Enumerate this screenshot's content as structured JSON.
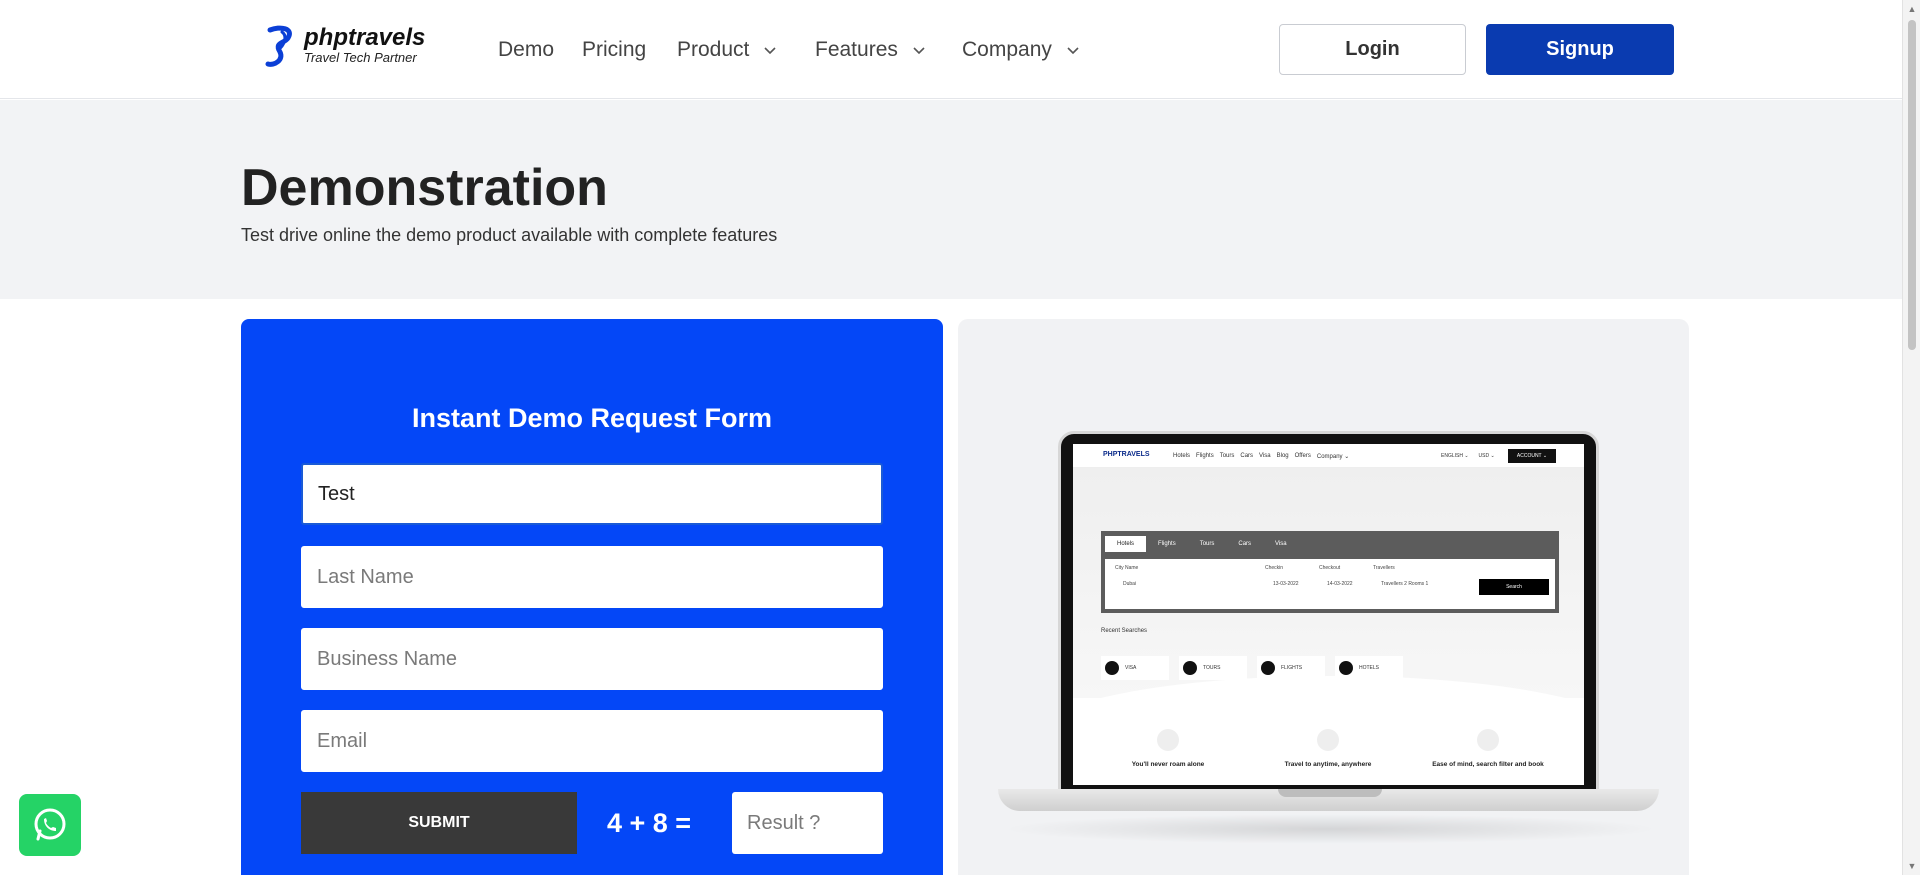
{
  "header": {
    "logo_name": "phptravels",
    "logo_tagline": "Travel Tech Partner",
    "nav": [
      {
        "label": "Demo"
      },
      {
        "label": "Pricing"
      },
      {
        "label": "Product"
      },
      {
        "label": "Features"
      },
      {
        "label": "Company"
      }
    ],
    "login_label": "Login",
    "signup_label": "Signup"
  },
  "hero": {
    "title": "Demonstration",
    "subtitle": "Test drive online the demo product available with complete features"
  },
  "form": {
    "title": "Instant Demo Request Form",
    "first_name_value": "Test",
    "last_name_placeholder": "Last Name",
    "business_name_placeholder": "Business Name",
    "email_placeholder": "Email",
    "submit_label": "SUBMIT",
    "captcha_text": "4 + 8 =",
    "result_placeholder": "Result ?"
  },
  "preview": {
    "logo": "PHPTRAVELS",
    "nav_links": [
      "Hotels",
      "Flights",
      "Tours",
      "Cars",
      "Visa",
      "Blog",
      "Offers",
      "Company ⌄"
    ],
    "language": "ENGLISH ⌄",
    "currency": "USD ⌄",
    "account": "ACCOUNT ⌄",
    "tabs": [
      "Hotels",
      "Flights",
      "Tours",
      "Cars",
      "Visa"
    ],
    "city_label": "City Name",
    "city_value": "Dubai",
    "checkin_label": "Checkin",
    "checkin_value": "13-03-2022",
    "checkout_label": "Checkout",
    "checkout_value": "14-03-2022",
    "travellers_label": "Travellers",
    "travellers_value": "Travellers 2 Rooms 1",
    "search_label": "Search",
    "recent_label": "Recent Searches",
    "recent_cards": [
      "VISA",
      "TOURS",
      "FLIGHTS",
      "HOTELS"
    ],
    "features": [
      "You'll never roam alone",
      "Travel to anytime, anywhere",
      "Ease of mind, search filter and book"
    ]
  },
  "colors": {
    "brand_blue": "#0447f7",
    "signup_blue": "#0a3bb0",
    "whatsapp_green": "#25d366"
  }
}
